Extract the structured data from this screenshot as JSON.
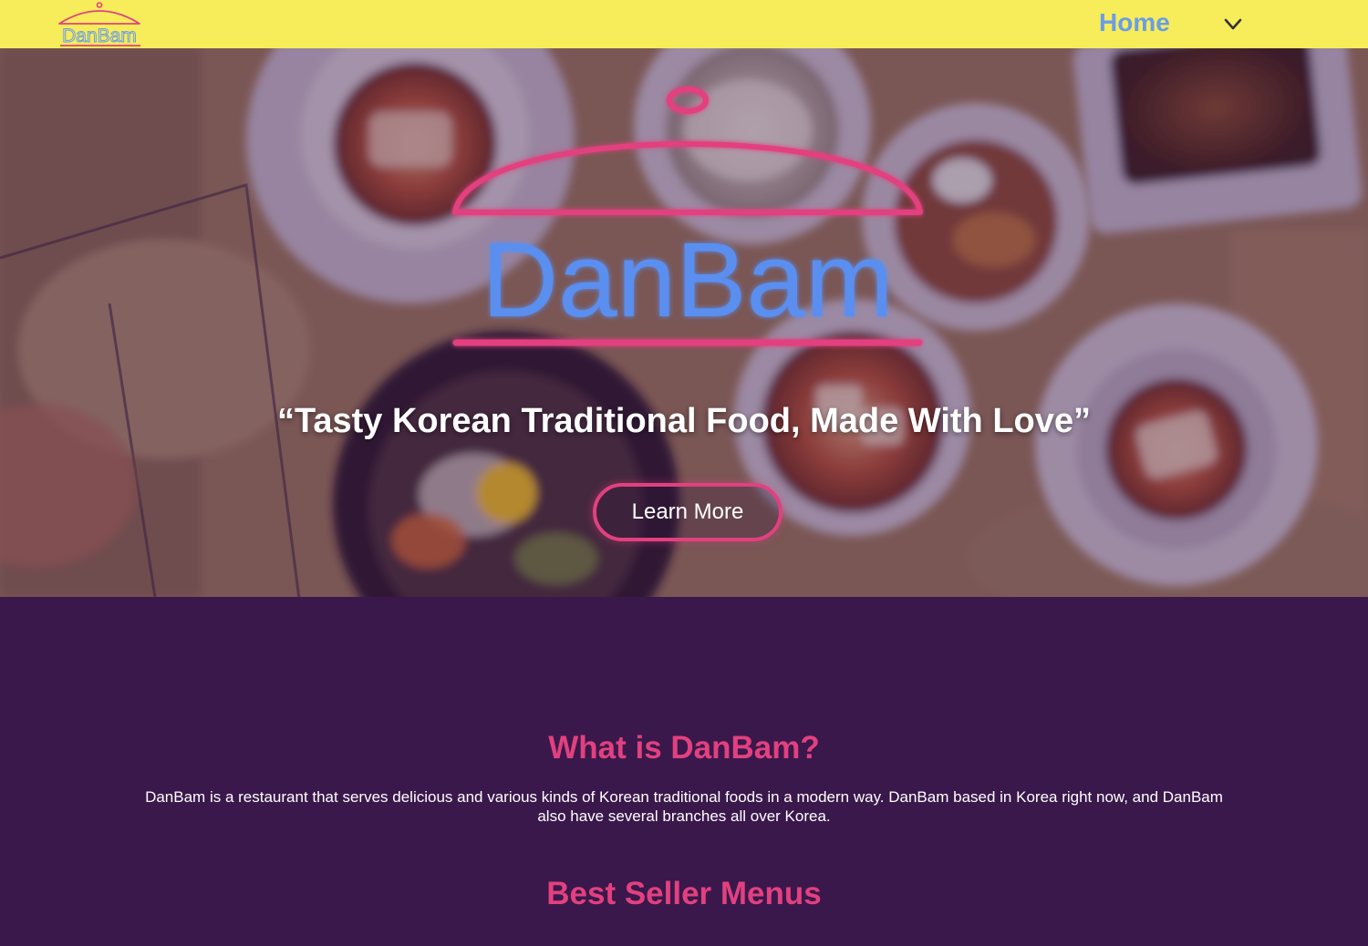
{
  "nav": {
    "logo_text": "DanBam",
    "home_label": "Home",
    "toggle_icon": "chevron-down-icon"
  },
  "hero": {
    "logo_text": "DanBam",
    "tagline": "“Tasty Korean Traditional Food, Made With Love”",
    "cta_label": "Learn More"
  },
  "about": {
    "title": "What is DanBam?",
    "text": "DanBam is a restaurant that serves delicious and various kinds of Korean traditional foods in a modern way. DanBam based in Korea right now, and DanBam also have several branches all over Korea."
  },
  "best_seller": {
    "title": "Best Seller Menus"
  },
  "colors": {
    "nav_bg": "#f7ec5a",
    "brand_blue": "#6a9de8",
    "brand_pink": "#e2407f",
    "page_bg": "#3a184b",
    "text_light": "#ffffff"
  }
}
